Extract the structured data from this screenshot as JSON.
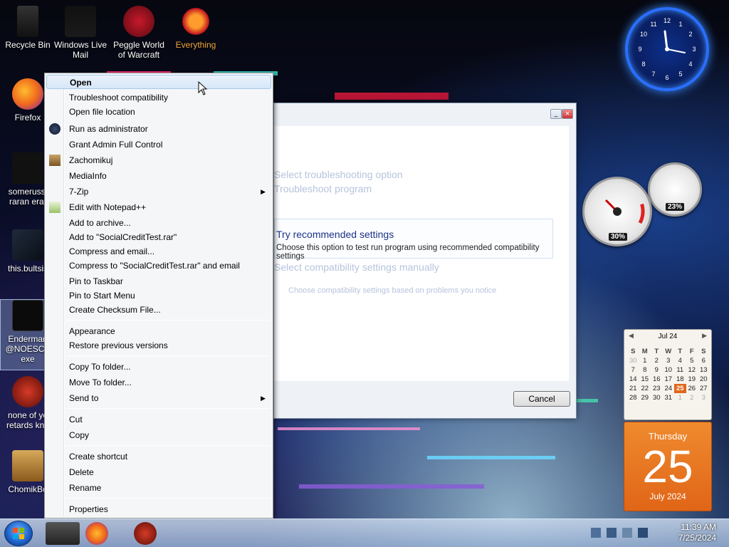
{
  "desktop_icons": [
    {
      "id": "recycle-bin",
      "label": "Recycle Bin"
    },
    {
      "id": "windows-live-mail",
      "label": "Windows Live Mail"
    },
    {
      "id": "people-world-of-warcraft",
      "label": "Peggle World of Warcraft"
    },
    {
      "id": "everything",
      "label": "Everything"
    },
    {
      "id": "firefox",
      "label": "Firefox"
    },
    {
      "id": "icon-2",
      "label": "somerussi raran erat"
    },
    {
      "id": "icon-3",
      "label": "this.bultsis"
    },
    {
      "id": "enderman-exe",
      "label": "Enderman @NOESCA exe"
    },
    {
      "id": "none-of-you",
      "label": "none of yo retards kno"
    },
    {
      "id": "chomikbox",
      "label": "ChomikBo"
    }
  ],
  "context_menu": {
    "items": [
      {
        "label": "Open"
      },
      {
        "label": "Troubleshoot compatibility"
      },
      {
        "label": "Open file location"
      },
      {
        "label": "Run as administrator"
      },
      {
        "label": "Grant Admin Full Control"
      },
      {
        "label": "Zachomikuj"
      },
      {
        "label": "MediaInfo"
      },
      {
        "label": "7-Zip"
      },
      {
        "label": "Edit with Notepad++"
      },
      {
        "label": "Add to archive..."
      },
      {
        "label": "Add to \"SocialCreditTest.rar\""
      },
      {
        "label": "Compress and email..."
      },
      {
        "label": "Compress to \"SocialCreditTest.rar\" and email"
      },
      {
        "label": "Pin to Taskbar"
      },
      {
        "label": "Pin to Start Menu"
      },
      {
        "label": "Create Checksum File..."
      },
      {
        "label": "Appearance"
      },
      {
        "label": "Restore previous versions"
      },
      {
        "label": "Copy To folder..."
      },
      {
        "label": "Move To folder..."
      },
      {
        "label": "Send to"
      },
      {
        "label": "Cut"
      },
      {
        "label": "Copy"
      },
      {
        "label": "Create shortcut"
      },
      {
        "label": "Delete"
      },
      {
        "label": "Rename"
      },
      {
        "label": "Properties"
      }
    ]
  },
  "compat_dialog": {
    "option_title": "Try recommended settings",
    "option_desc": "Choose this option to test run program using recommended compatibility settings",
    "ghost_lines": [
      "Select troubleshooting option",
      "Troubleshoot program",
      "Select compatibility settings manually",
      "Choose compatibility settings based on problems you notice"
    ],
    "cancel_label": "Cancel"
  },
  "meter": {
    "cpu_value": "30%",
    "ram_value": "23%"
  },
  "calendar": {
    "month_label": "Jul 24",
    "days_of_week": [
      "S",
      "M",
      "T",
      "W",
      "T",
      "F",
      "S"
    ],
    "weeks": [
      [
        "30",
        "1",
        "2",
        "3",
        "4",
        "5",
        "6"
      ],
      [
        "7",
        "8",
        "9",
        "10",
        "11",
        "12",
        "13"
      ],
      [
        "14",
        "15",
        "16",
        "17",
        "18",
        "19",
        "20"
      ],
      [
        "21",
        "22",
        "23",
        "24",
        "25",
        "26",
        "27"
      ],
      [
        "28",
        "29",
        "30",
        "31",
        "1",
        "2",
        "3"
      ]
    ],
    "today": "25"
  },
  "date_gadget": {
    "weekday": "Thursday",
    "day": "25",
    "month_year": "July 2024"
  },
  "taskbar": {
    "time": "11:39 AM",
    "date": "7/25/2024"
  },
  "colors": {
    "accent": "#e06517",
    "clock_glow": "#2a6fff"
  }
}
